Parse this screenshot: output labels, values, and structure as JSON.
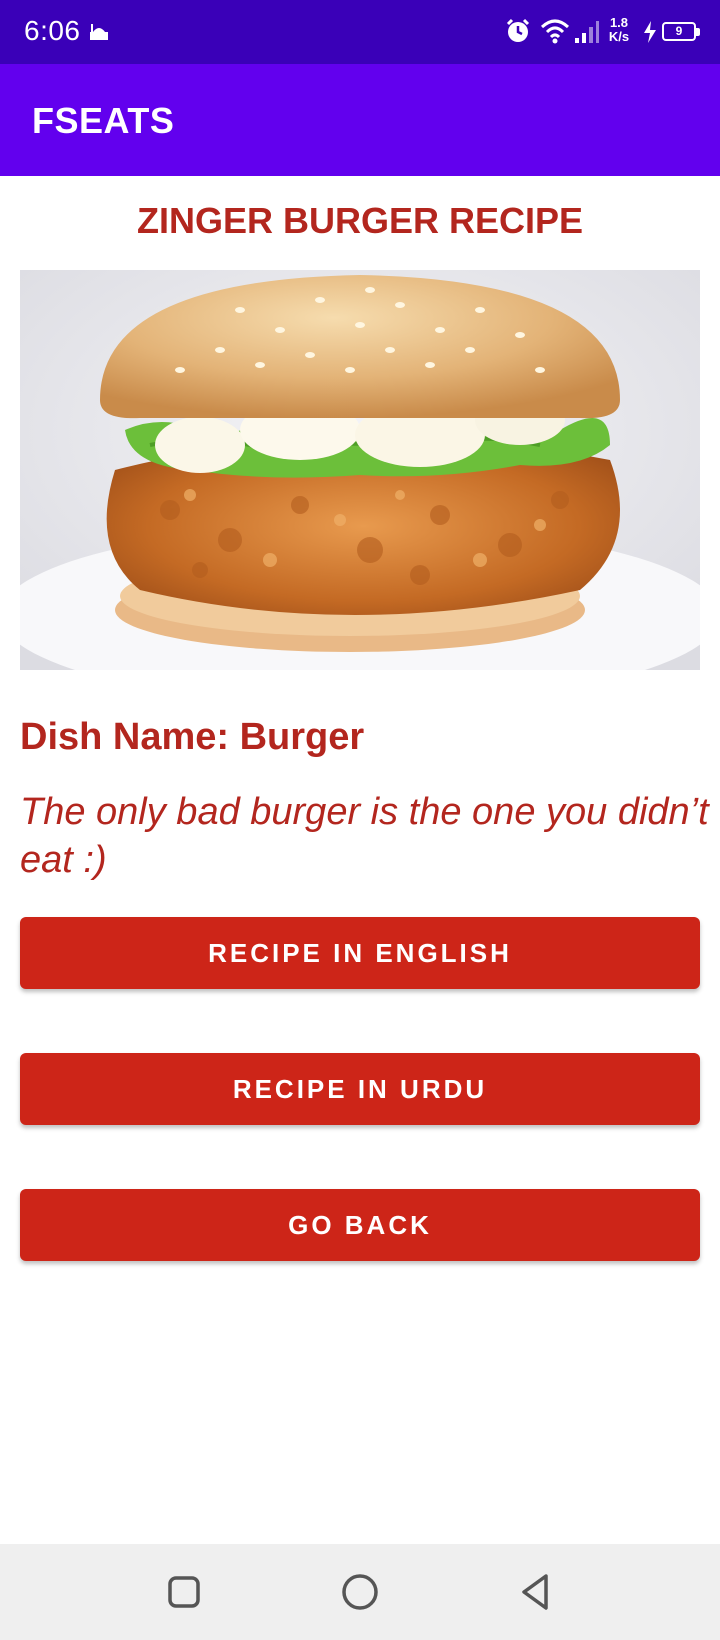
{
  "status_bar": {
    "time": "6:06",
    "net_speed_value": "1.8",
    "net_speed_unit": "K/s",
    "battery": "9",
    "icons": [
      "mosque-notification-icon",
      "alarm-icon",
      "wifi-icon",
      "signal-icon",
      "charging-icon",
      "battery-icon"
    ]
  },
  "app_bar": {
    "title": "FSEATS"
  },
  "content": {
    "heading": "ZINGER BURGER RECIPE",
    "image_alt": "zinger-burger-photo",
    "dish_name": "Dish Name: Burger",
    "quote": "The only bad burger is the one you didn’t eat :)"
  },
  "buttons": {
    "english": "RECIPE IN ENGLISH",
    "urdu": "RECIPE IN URDU",
    "back": "GO BACK"
  },
  "nav_bar": {
    "icons": [
      "recents-icon",
      "home-icon",
      "back-icon"
    ]
  },
  "colors": {
    "status_bar": "#3a00b8",
    "app_bar": "#6200ee",
    "accent_text": "#b3261e",
    "button": "#cd2518"
  }
}
